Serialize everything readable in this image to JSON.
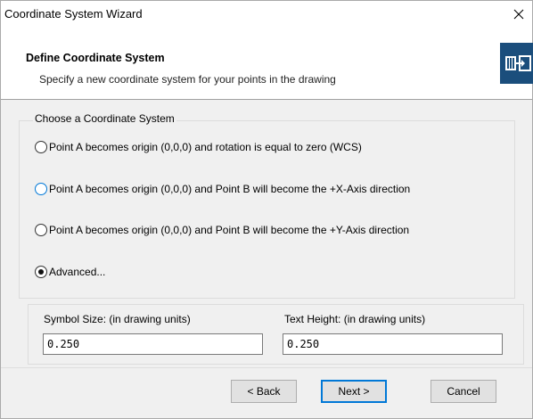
{
  "window": {
    "title": "Coordinate System Wizard"
  },
  "header": {
    "title": "Define Coordinate System",
    "subtitle": "Specify a new coordinate system for your points in the drawing",
    "logo_icon": "coordinate-system-wizard-icon"
  },
  "group": {
    "legend": "Choose a Coordinate System",
    "options": [
      {
        "label": "Point A becomes origin (0,0,0) and rotation is equal to zero (WCS)",
        "selected": false
      },
      {
        "label": "Point A becomes origin (0,0,0) and Point B will become the +X-Axis direction",
        "selected": false
      },
      {
        "label": "Point A becomes origin (0,0,0) and Point B will become the +Y-Axis direction",
        "selected": false
      },
      {
        "label": "Advanced...",
        "selected": true
      }
    ]
  },
  "fields": {
    "symbol_size": {
      "label": "Symbol Size: (in drawing units)",
      "value": "0.250"
    },
    "text_height": {
      "label": "Text Height: (in drawing units)",
      "value": "0.250"
    }
  },
  "buttons": {
    "back": "< Back",
    "next": "Next >",
    "cancel": "Cancel"
  },
  "colors": {
    "accent": "#0078d7",
    "logo_bg": "#1b4e7c",
    "body_bg": "#f0f0f0"
  }
}
